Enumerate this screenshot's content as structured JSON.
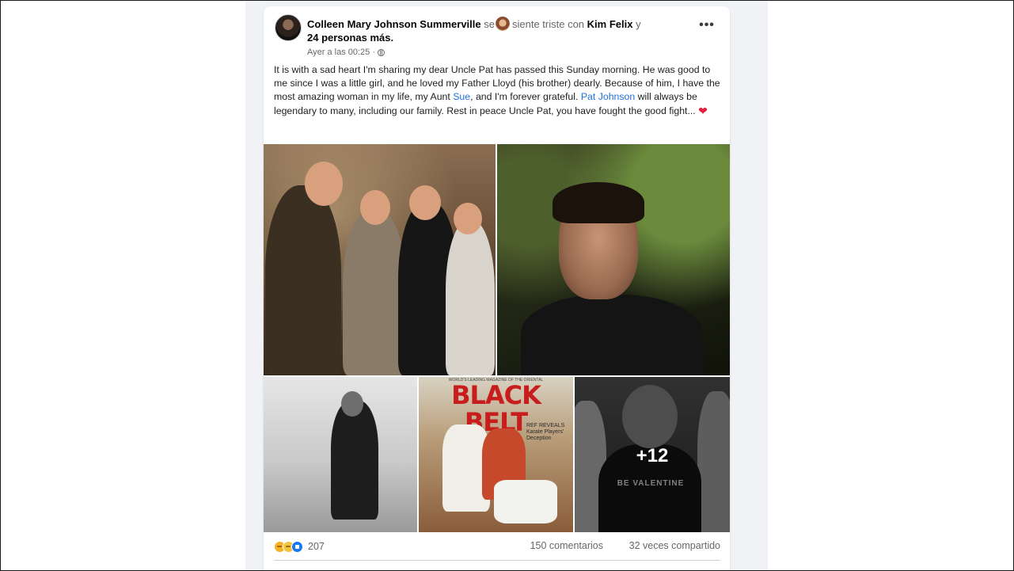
{
  "post": {
    "author": "Colleen Mary Johnson Summerville",
    "verb_se": "se",
    "feeling": "siente triste con",
    "tagged_user": "Kim Felix",
    "conjunction": "y",
    "others": "24 personas más.",
    "timestamp": "Ayer a las 00:25 ·",
    "more_options": "•••",
    "body": {
      "part1": "It is with a sad heart I'm sharing my dear Uncle Pat has passed this Sunday morning. He was good to me since I was a little girl, and he loved my Father Lloyd (his brother) dearly. Because of him, I have the most amazing woman in my life, my Aunt ",
      "mention1": "Sue",
      "part2": ", and I'm forever grateful.  ",
      "mention2": "Pat Johnson",
      "part3": " will always be legendary to many, including our family. Rest in peace Uncle Pat, you have fought the good fight... ",
      "heart": "❤"
    }
  },
  "photos": {
    "magazine_kicker": "WORLD'S LEADING MAGAZINE OF THE ORIENTAL",
    "magazine_title": "BLACK BELT",
    "magazine_subtitle": "REF REVEALS Karate Players' Deception",
    "shirt_text": "BE VALENTINE",
    "more_count": "+12"
  },
  "stats": {
    "reactions_count": "207",
    "comments": "150 comentarios",
    "shares": "32 veces compartido"
  },
  "icons": {
    "reactions": [
      "care-icon",
      "sad-icon",
      "like-icon"
    ],
    "privacy": "globe-icon",
    "feeling": "mood-icon"
  },
  "colors": {
    "link": "#216fdb",
    "background": "#f0f2f5",
    "card": "#ffffff",
    "magazine_red": "#c81d1d"
  }
}
